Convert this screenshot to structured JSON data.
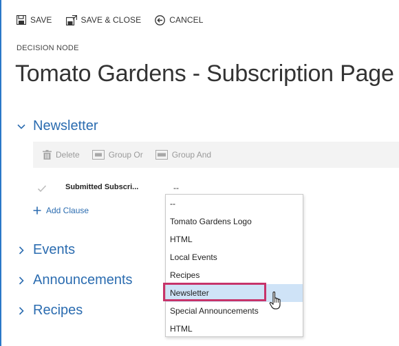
{
  "toolbar": {
    "save_label": "SAVE",
    "save_close_label": "SAVE & CLOSE",
    "cancel_label": "CANCEL"
  },
  "page": {
    "node_type": "DECISION NODE",
    "title": "Tomato Gardens - Subscription Page"
  },
  "sections": [
    {
      "label": "Newsletter",
      "expanded": true
    },
    {
      "label": "Events",
      "expanded": false
    },
    {
      "label": "Announcements",
      "expanded": false
    },
    {
      "label": "Recipes",
      "expanded": false
    }
  ],
  "clause_toolbar": {
    "delete_label": "Delete",
    "group_or_label": "Group Or",
    "group_and_label": "Group And"
  },
  "clause": {
    "name": "Submitted Subscri...",
    "value": "--"
  },
  "add_clause_label": "Add Clause",
  "dropdown": {
    "options": [
      "--",
      "Tomato Gardens Logo",
      "HTML",
      "Local Events",
      "Recipes",
      "Newsletter",
      "Special Announcements",
      "HTML"
    ],
    "hovered_index": 5
  },
  "colors": {
    "accent": "#2b6cb0",
    "highlight_border": "#c7336a",
    "hover_bg": "#cfe3f7"
  }
}
